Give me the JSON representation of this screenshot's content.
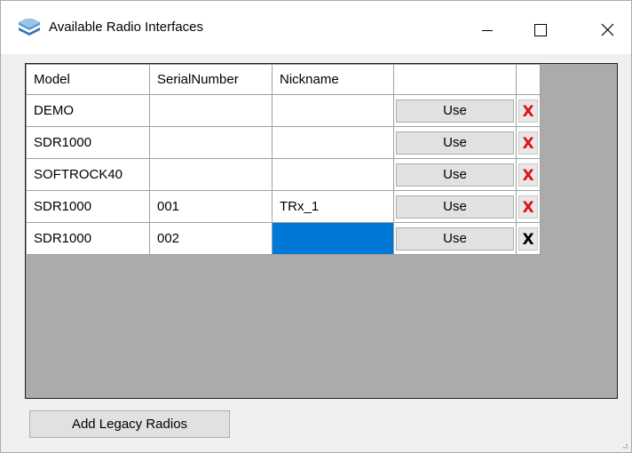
{
  "window": {
    "title": "Available Radio Interfaces",
    "icon": "radio-waves-icon",
    "controls": {
      "minimize": "minimize-icon",
      "maximize": "maximize-icon",
      "close": "close-icon"
    }
  },
  "grid": {
    "columns": [
      "Model",
      "SerialNumber",
      "Nickname",
      ""
    ],
    "use_label": "Use",
    "delete_label": "X",
    "rows": [
      {
        "model": "DEMO",
        "serial": "",
        "nickname": "",
        "delete_style": "red"
      },
      {
        "model": "SDR1000",
        "serial": "",
        "nickname": "",
        "delete_style": "red"
      },
      {
        "model": "SOFTROCK40",
        "serial": "",
        "nickname": "",
        "delete_style": "red"
      },
      {
        "model": "SDR1000",
        "serial": "001",
        "nickname": "TRx_1",
        "delete_style": "red"
      },
      {
        "model": "SDR1000",
        "serial": "002",
        "nickname": "",
        "delete_style": "black",
        "nickname_selected": true
      }
    ]
  },
  "footer": {
    "legacy_button": "Add Legacy Radios"
  },
  "colors": {
    "selection": "#0078d7",
    "grid_background": "#ababab",
    "delete_red": "#e01010"
  }
}
